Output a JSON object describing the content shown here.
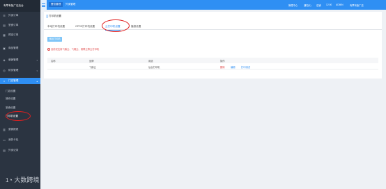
{
  "brand": "有草有饭厂店后台",
  "sidebar": {
    "items": [
      {
        "label": "外卖订单",
        "icon": "list-icon"
      },
      {
        "label": "堂食订单",
        "icon": "doc-icon"
      },
      {
        "label": "预定订单",
        "icon": "calendar-icon"
      },
      {
        "label": "商品管理",
        "icon": "box-icon"
      },
      {
        "label": "营销管理",
        "icon": "tag-icon"
      },
      {
        "label": "财务管理",
        "icon": "wallet-icon"
      },
      {
        "label": "门店管理",
        "icon": "store-icon"
      }
    ],
    "subitems": [
      "门店设置",
      "操作设置",
      "堂食设置",
      "打印机设置"
    ],
    "items_after": [
      {
        "label": "营销报表",
        "icon": "chart-icon"
      },
      {
        "label": "我的卡包",
        "icon": "card-icon"
      },
      {
        "label": "外卖记录",
        "icon": "record-icon"
      }
    ]
  },
  "topbar": {
    "tabs": [
      "餐饮管理",
      "外卖管理"
    ],
    "right": [
      "管理中心",
      "通知(1)",
      "店铺",
      "12:00",
      "ADMIN",
      "有草有饭厂店"
    ]
  },
  "panel": {
    "title": "打印机设置",
    "tabs": [
      "本地打印机设置",
      "GPRS打印机设置",
      "云打印机设置",
      "播报设置"
    ],
    "active_tab": 2,
    "add_button": "添加打印机",
    "notice": "目前仅支持飞鹅云、飞蛾云、易联云等云打印机",
    "columns": [
      "名称",
      "品牌",
      "用途",
      "操作"
    ],
    "rows": [
      {
        "name": "",
        "brand": "飞鹅云",
        "usage": "后台打印机",
        "ops": [
          "删除",
          "编辑",
          "打印测试"
        ]
      }
    ]
  },
  "watermark": {
    "main": "大数跨境",
    "prefix": "1"
  }
}
